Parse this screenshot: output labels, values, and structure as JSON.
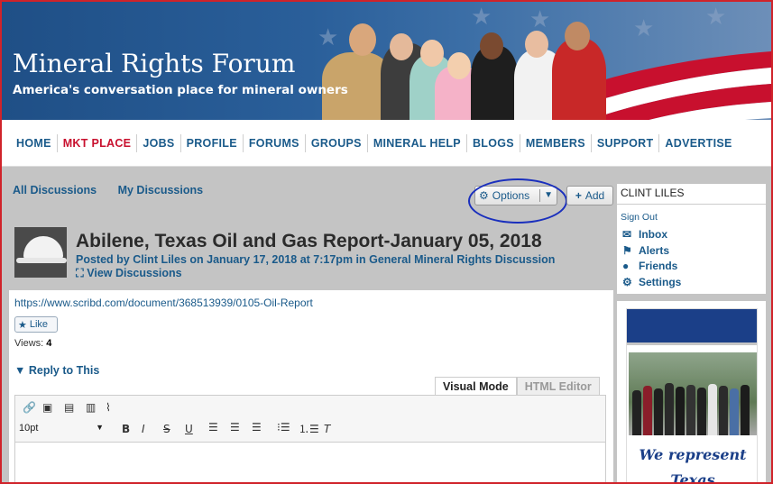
{
  "header": {
    "site_title": "Mineral Rights Forum",
    "tagline": "America's conversation place for mineral owners"
  },
  "nav": {
    "items": [
      "HOME",
      "MKT PLACE",
      "JOBS",
      "PROFILE",
      "FORUMS",
      "GROUPS",
      "MINERAL HELP",
      "BLOGS",
      "MEMBERS",
      "SUPPORT",
      "ADVERTISE"
    ],
    "highlight_index": 1
  },
  "discussion_tabs": {
    "all": "All Discussions",
    "mine": "My Discussions"
  },
  "actions": {
    "options_label": "Options",
    "add_label": "Add"
  },
  "post": {
    "title": "Abilene, Texas Oil and Gas Report-January 05, 2018",
    "meta": "Posted by Clint Liles on January 17, 2018 at 7:17pm in General Mineral Rights Discussion",
    "view_discussions": "View Discussions",
    "link": "https://www.scribd.com/document/368513939/0105-Oil-Report",
    "like_label": "Like",
    "views_label": "Views:",
    "views_count": "4",
    "reply_label": "▼ Reply to This"
  },
  "editor": {
    "tab_visual": "Visual Mode",
    "tab_html": "HTML Editor",
    "font_size": "10pt"
  },
  "user_panel": {
    "name": "CLINT LILES",
    "sign_out": "Sign Out",
    "links": {
      "inbox": "Inbox",
      "alerts": "Alerts",
      "friends": "Friends",
      "settings": "Settings"
    }
  },
  "ad": {
    "line1": "We represent",
    "line2": "Texas"
  },
  "colors": {
    "link_blue": "#1a5a8a",
    "highlight_red": "#c8102e",
    "annotation_blue": "#1a2fbd",
    "frame_red": "#d0232a"
  }
}
